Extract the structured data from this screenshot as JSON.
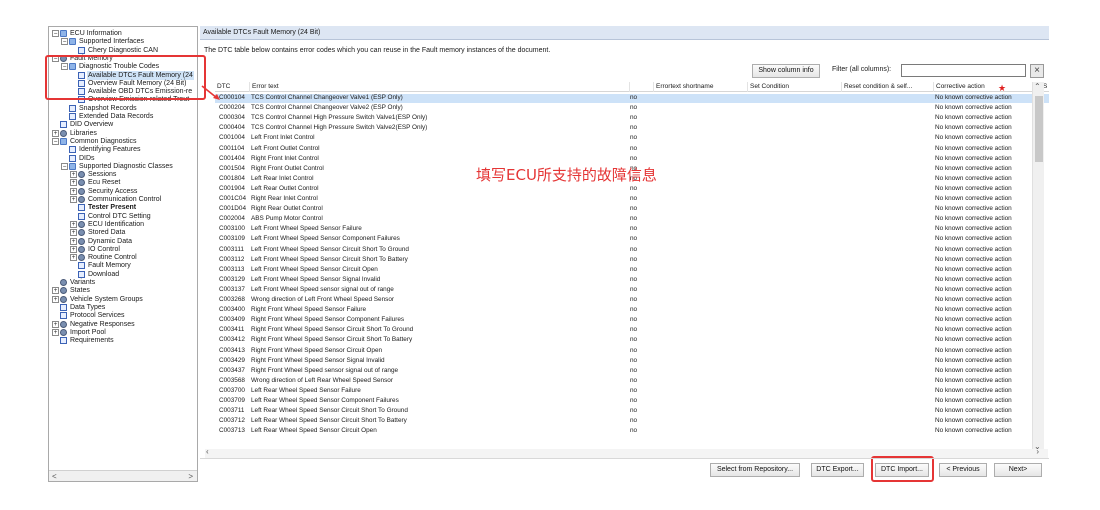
{
  "tree": {
    "items": [
      {
        "label": "ECU Information",
        "level": 0,
        "expander": "−",
        "icon": "folder"
      },
      {
        "label": "Supported Interfaces",
        "level": 1,
        "expander": "−",
        "icon": "folder"
      },
      {
        "label": "Chery Diagnostic CAN",
        "level": 2,
        "expander": "",
        "icon": "doc"
      },
      {
        "label": "Fault Memory",
        "level": 0,
        "expander": "−",
        "icon": "gear"
      },
      {
        "label": "Diagnostic Trouble Codes",
        "level": 1,
        "expander": "−",
        "icon": "folder"
      },
      {
        "label": "Available DTCs Fault Memory (24",
        "level": 2,
        "expander": "",
        "icon": "doc",
        "selected": true
      },
      {
        "label": "Overview Fault Memory (24 Bit)",
        "level": 2,
        "expander": "",
        "icon": "doc"
      },
      {
        "label": "Available OBD DTCs Emission-re",
        "level": 2,
        "expander": "",
        "icon": "doc"
      },
      {
        "label": "Overview Emission-related Trout",
        "level": 2,
        "expander": "",
        "icon": "doc"
      },
      {
        "label": "Snapshot Records",
        "level": 1,
        "expander": "",
        "icon": "doc"
      },
      {
        "label": "Extended Data Records",
        "level": 1,
        "expander": "",
        "icon": "doc"
      },
      {
        "label": "DID Overview",
        "level": 0,
        "expander": "",
        "icon": "doc"
      },
      {
        "label": "Libraries",
        "level": 0,
        "expander": "+",
        "icon": "gear"
      },
      {
        "label": "Common Diagnostics",
        "level": 0,
        "expander": "−",
        "icon": "folder"
      },
      {
        "label": "Identifying Features",
        "level": 1,
        "expander": "",
        "icon": "doc"
      },
      {
        "label": "DIDs",
        "level": 1,
        "expander": "",
        "icon": "doc"
      },
      {
        "label": "Supported Diagnostic Classes",
        "level": 1,
        "expander": "−",
        "icon": "folder"
      },
      {
        "label": "Sessions",
        "level": 2,
        "expander": "+",
        "icon": "gear"
      },
      {
        "label": "Ecu Reset",
        "level": 2,
        "expander": "+",
        "icon": "gear"
      },
      {
        "label": "Security Access",
        "level": 2,
        "expander": "+",
        "icon": "gear"
      },
      {
        "label": "Communication Control",
        "level": 2,
        "expander": "+",
        "icon": "gear"
      },
      {
        "label": "Tester Present",
        "level": 2,
        "expander": "",
        "icon": "doc",
        "bold": true
      },
      {
        "label": "Control DTC Setting",
        "level": 2,
        "expander": "",
        "icon": "doc"
      },
      {
        "label": "ECU Identification",
        "level": 2,
        "expander": "+",
        "icon": "gear"
      },
      {
        "label": "Stored Data",
        "level": 2,
        "expander": "+",
        "icon": "gear"
      },
      {
        "label": "Dynamic Data",
        "level": 2,
        "expander": "+",
        "icon": "gear"
      },
      {
        "label": "IO Control",
        "level": 2,
        "expander": "+",
        "icon": "gear"
      },
      {
        "label": "Routine Control",
        "level": 2,
        "expander": "+",
        "icon": "gear"
      },
      {
        "label": "Fault Memory",
        "level": 2,
        "expander": "",
        "icon": "doc"
      },
      {
        "label": "Download",
        "level": 2,
        "expander": "",
        "icon": "doc"
      },
      {
        "label": "Variants",
        "level": 0,
        "expander": "",
        "icon": "gear"
      },
      {
        "label": "States",
        "level": 0,
        "expander": "+",
        "icon": "gear"
      },
      {
        "label": "Vehicle System Groups",
        "level": 0,
        "expander": "+",
        "icon": "gear"
      },
      {
        "label": "Data Types",
        "level": 0,
        "expander": "",
        "icon": "doc"
      },
      {
        "label": "Protocol Services",
        "level": 0,
        "expander": "",
        "icon": "doc"
      },
      {
        "label": "Negative Responses",
        "level": 0,
        "expander": "+",
        "icon": "gear"
      },
      {
        "label": "Import Pool",
        "level": 0,
        "expander": "+",
        "icon": "gear"
      },
      {
        "label": "Requirements",
        "level": 0,
        "expander": "",
        "icon": "doc"
      }
    ],
    "scroll_left": "<",
    "scroll_right": ">"
  },
  "panel": {
    "title": "Available DTCs Fault Memory (24 Bit)",
    "description": "The DTC table below contains error codes which you can reuse in the Fault memory instances of the document.",
    "show_column_info": "Show column info",
    "filter_label": "Filter (all columns):",
    "filter_value": "",
    "clear_icon": "×"
  },
  "annotation": "填写ECU所支持的故障信息",
  "table": {
    "columns": [
      "DTC",
      "Error text",
      "",
      "Errortext shortname",
      "Set Condition",
      "Reset condition & self...",
      "Corrective action",
      "S"
    ],
    "rows": [
      {
        "dtc": "C000104",
        "text": "TCS Control Channel Changeover Valve1 (ESP Only)",
        "no": "no",
        "action": "No known corrective action",
        "selected": true
      },
      {
        "dtc": "C000204",
        "text": "TCS Control Channel Changeover Valve2 (ESP Only)",
        "no": "no",
        "action": "No known corrective action"
      },
      {
        "dtc": "C000304",
        "text": "TCS Control Channel High Pressure Switch Valve1(ESP Only)",
        "no": "no",
        "action": "No known corrective action"
      },
      {
        "dtc": "C000404",
        "text": "TCS Control Channel High Pressure Switch Valve2(ESP Only)",
        "no": "no",
        "action": "No known corrective action"
      },
      {
        "dtc": "C001004",
        "text": "Left Front Inlet Control",
        "no": "no",
        "action": "No known corrective action"
      },
      {
        "dtc": "C001104",
        "text": "Left Front Outlet Control",
        "no": "no",
        "action": "No known corrective action"
      },
      {
        "dtc": "C001404",
        "text": "Right Front Inlet Control",
        "no": "no",
        "action": "No known corrective action"
      },
      {
        "dtc": "C001504",
        "text": "Right Front Outlet Control",
        "no": "no",
        "action": "No known corrective action"
      },
      {
        "dtc": "C001804",
        "text": "Left Rear Inlet Control",
        "no": "no",
        "action": "No known corrective action"
      },
      {
        "dtc": "C001904",
        "text": "Left Rear Outlet Control",
        "no": "no",
        "action": "No known corrective action"
      },
      {
        "dtc": "C001C04",
        "text": "Right Rear Inlet Control",
        "no": "no",
        "action": "No known corrective action"
      },
      {
        "dtc": "C001D04",
        "text": "Right Rear Outlet Control",
        "no": "no",
        "action": "No known corrective action"
      },
      {
        "dtc": "C002004",
        "text": "ABS Pump Motor Control",
        "no": "no",
        "action": "No known corrective action"
      },
      {
        "dtc": "C003100",
        "text": "Left Front Wheel Speed Sensor Failure",
        "no": "no",
        "action": "No known corrective action"
      },
      {
        "dtc": "C003109",
        "text": "Left Front Wheel Speed Sensor Component Failures",
        "no": "no",
        "action": "No known corrective action"
      },
      {
        "dtc": "C003111",
        "text": "Left Front Wheel Speed Sensor Circuit Short To Ground",
        "no": "no",
        "action": "No known corrective action"
      },
      {
        "dtc": "C003112",
        "text": "Left Front Wheel Speed Sensor Circuit Short To Battery",
        "no": "no",
        "action": "No known corrective action"
      },
      {
        "dtc": "C003113",
        "text": "Left Front Wheel Speed Sensor Circuit Open",
        "no": "no",
        "action": "No known corrective action"
      },
      {
        "dtc": "C003129",
        "text": "Left Front Wheel Speed Sensor Signal Invalid",
        "no": "no",
        "action": "No known corrective action"
      },
      {
        "dtc": "C003137",
        "text": "Left Front Wheel Speed sensor signal out of range",
        "no": "no",
        "action": "No known corrective action"
      },
      {
        "dtc": "C003268",
        "text": "Wrong direction of Left Front Wheel Speed Sensor",
        "no": "no",
        "action": "No known corrective action"
      },
      {
        "dtc": "C003400",
        "text": "Right Front Wheel Speed Sensor Failure",
        "no": "no",
        "action": "No known corrective action"
      },
      {
        "dtc": "C003409",
        "text": "Right Front Wheel Speed Sensor Component Failures",
        "no": "no",
        "action": "No known corrective action"
      },
      {
        "dtc": "C003411",
        "text": "Right Front Wheel Speed Sensor Circuit Short To Ground",
        "no": "no",
        "action": "No known corrective action"
      },
      {
        "dtc": "C003412",
        "text": "Right Front Wheel Speed Sensor Circuit Short To Battery",
        "no": "no",
        "action": "No known corrective action"
      },
      {
        "dtc": "C003413",
        "text": "Right Front Wheel Speed Sensor Circuit Open",
        "no": "no",
        "action": "No known corrective action"
      },
      {
        "dtc": "C003429",
        "text": "Right Front Wheel Speed Sensor Signal Invalid",
        "no": "no",
        "action": "No known corrective action"
      },
      {
        "dtc": "C003437",
        "text": "Right Front Wheel Speed sensor signal out of range",
        "no": "no",
        "action": "No known corrective action"
      },
      {
        "dtc": "C003568",
        "text": "Wrong direction of Left Rear Wheel Speed Sensor",
        "no": "no",
        "action": "No known corrective action"
      },
      {
        "dtc": "C003700",
        "text": "Left Rear Wheel Speed Sensor Failure",
        "no": "no",
        "action": "No known corrective action"
      },
      {
        "dtc": "C003709",
        "text": "Left Rear Wheel Speed Sensor Component Failures",
        "no": "no",
        "action": "No known corrective action"
      },
      {
        "dtc": "C003711",
        "text": "Left Rear Wheel Speed Sensor Circuit Short To Ground",
        "no": "no",
        "action": "No known corrective action"
      },
      {
        "dtc": "C003712",
        "text": "Left Rear Wheel Speed Sensor Circuit Short To Battery",
        "no": "no",
        "action": "No known corrective action"
      },
      {
        "dtc": "C003713",
        "text": "Left Rear Wheel Speed Sensor Circuit Open",
        "no": "no",
        "action": "No known corrective action"
      }
    ]
  },
  "footer": {
    "select_from_repository": "Select from Repository...",
    "dtc_export": "DTC Export...",
    "dtc_import": "DTC Import...",
    "previous": "< Previous",
    "next": "Next>"
  }
}
